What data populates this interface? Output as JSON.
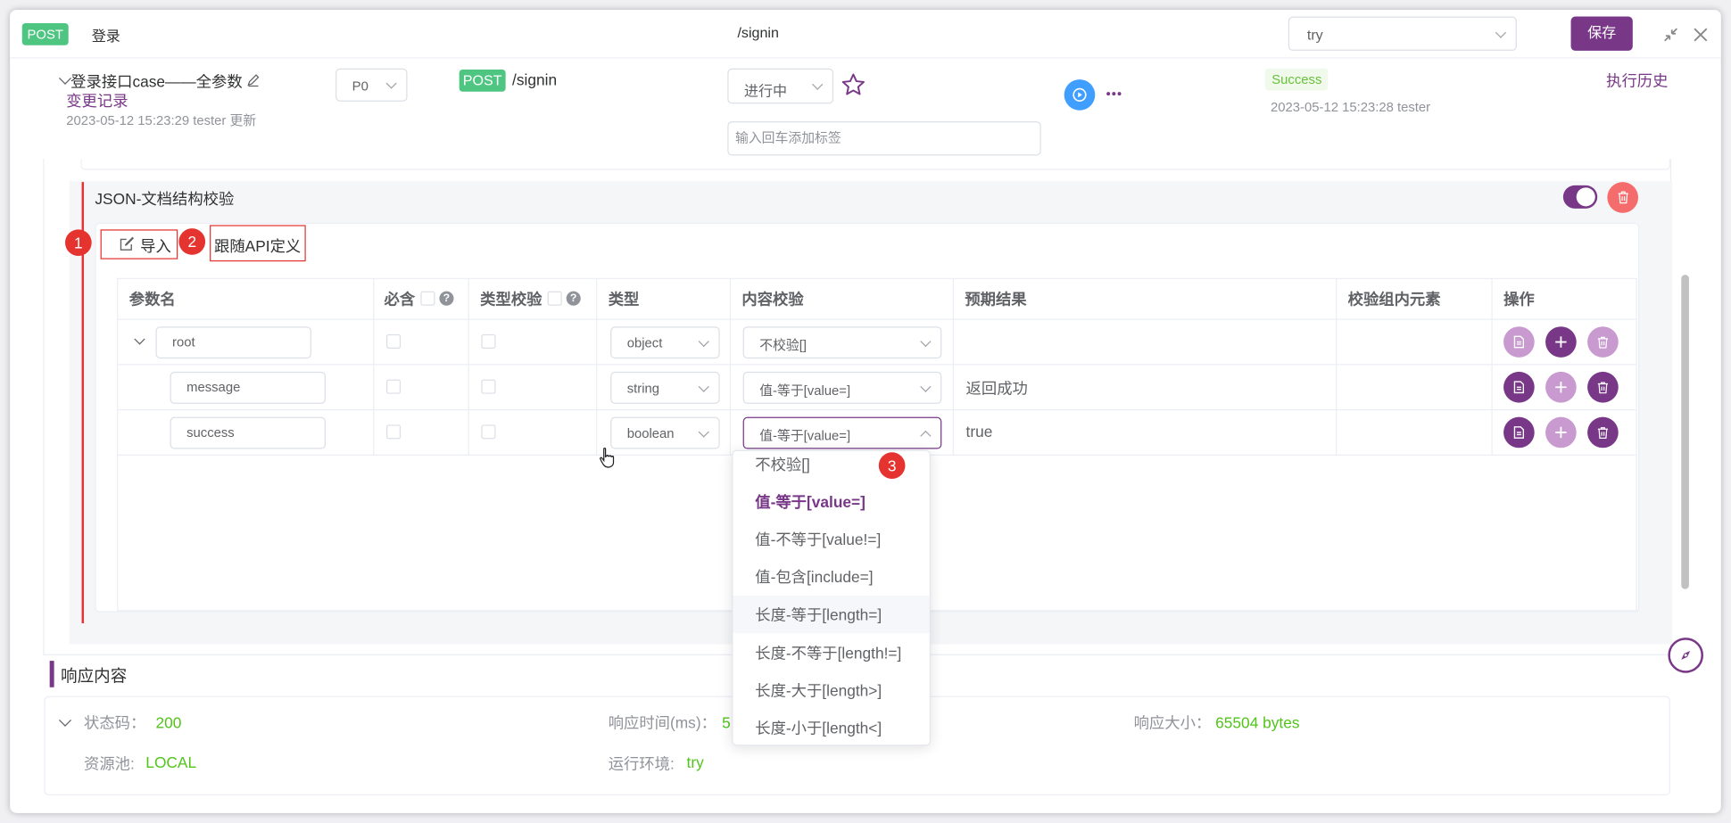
{
  "header": {
    "method": "POST",
    "title": "登录",
    "path": "/signin",
    "env": "try",
    "save": "保存"
  },
  "case": {
    "name": "登录接口case——全参数",
    "history_link": "变更记录",
    "updated": "2023-05-12 15:23:29 tester 更新",
    "priority": "P0",
    "method": "POST",
    "path": "/signin",
    "status": "进行中",
    "tag_placeholder": "输入回车添加标签",
    "result": "Success",
    "result_time": "2023-05-12 15:23:28 tester",
    "exec_history": "执行历史"
  },
  "json_check": {
    "title": "JSON-文档结构校验",
    "import": "导入",
    "follow_api": "跟随API定义",
    "columns": [
      "参数名",
      "必含",
      "类型校验",
      "类型",
      "内容校验",
      "预期结果",
      "校验组内元素",
      "操作"
    ],
    "rows": [
      {
        "name": "root",
        "type": "object",
        "check": "不校验[]",
        "expected": ""
      },
      {
        "name": "message",
        "type": "string",
        "check": "值-等于[value=]",
        "expected": "返回成功"
      },
      {
        "name": "success",
        "type": "boolean",
        "check": "值-等于[value=]",
        "expected": "true"
      }
    ]
  },
  "dropdown": {
    "options": [
      "不校验[]",
      "值-等于[value=]",
      "值-不等于[value!=]",
      "值-包含[include=]",
      "长度-等于[length=]",
      "长度-不等于[length!=]",
      "长度-大于[length>]",
      "长度-小于[length<]"
    ],
    "selected": "值-等于[value=]",
    "hovered": "长度-等于[length=]"
  },
  "badges": [
    "1",
    "2",
    "3"
  ],
  "response": {
    "title": "响应内容",
    "status_label": "状态码：",
    "status_value": "200",
    "time_label": "响应时间(ms)：",
    "time_value": "5",
    "size_label": "响应大小：",
    "size_value": "65504 bytes",
    "pool_label": "资源池:",
    "pool_value": "LOCAL",
    "env_label": "运行环境:",
    "env_value": "try"
  },
  "colors": {
    "accent": "#783887",
    "post": "#4ec682",
    "success": "#52c41a",
    "danger": "#f56c6c",
    "annotation": "#e5342f"
  }
}
